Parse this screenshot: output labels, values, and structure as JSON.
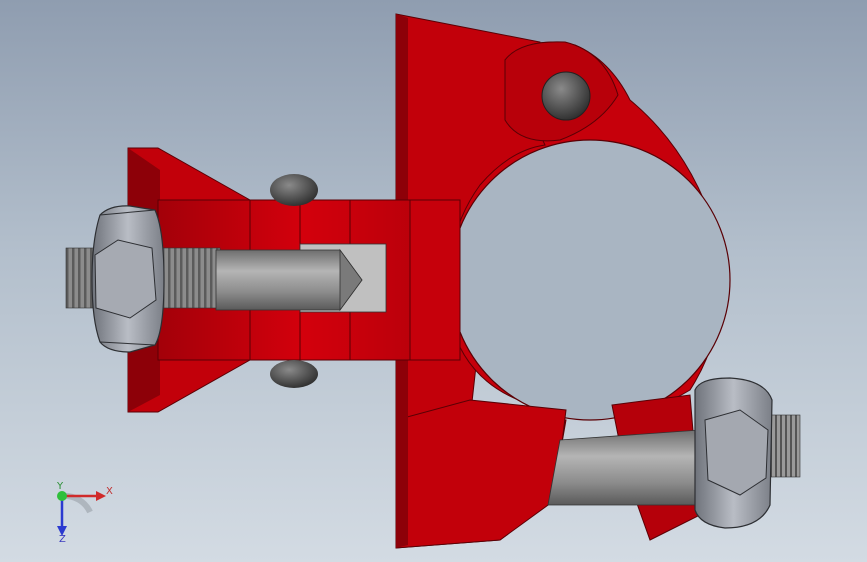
{
  "viewport": {
    "background_top": "#8f9db0",
    "background_bottom": "#d3dbe3"
  },
  "model": {
    "part_color": "#c2000a",
    "part_shadow": "#8d0008",
    "bolt_color": "#8a8a8a",
    "nut_color": "#9a9ea6"
  },
  "triad": {
    "x_label": "X",
    "y_label": "Y",
    "z_label": "Z"
  }
}
